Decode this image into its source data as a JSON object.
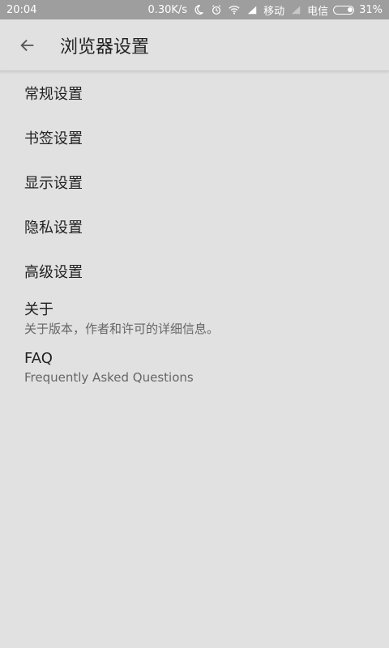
{
  "status_bar": {
    "time": "20:04",
    "speed": "0.30K/s",
    "carrier1": "移动",
    "carrier2": "电信",
    "battery": "31%",
    "battery_level": 0.31,
    "icons": [
      "moon-icon",
      "alarm-icon",
      "wifi-icon",
      "signal-icon",
      "signal-icon",
      "battery-icon"
    ]
  },
  "appbar": {
    "back_icon": "arrow-left-icon",
    "title": "浏览器设置"
  },
  "settings": {
    "items": [
      {
        "title": "常规设置"
      },
      {
        "title": "书签设置"
      },
      {
        "title": "显示设置"
      },
      {
        "title": "隐私设置"
      },
      {
        "title": "高级设置"
      },
      {
        "title": "关于",
        "subtitle": "关于版本，作者和许可的详细信息。"
      },
      {
        "title": "FAQ",
        "subtitle": "Frequently Asked Questions"
      }
    ]
  },
  "colors": {
    "background": "#e1e1e1",
    "status_bar": "#9e9e9e",
    "text_primary": "#212121",
    "text_secondary": "#666666"
  }
}
